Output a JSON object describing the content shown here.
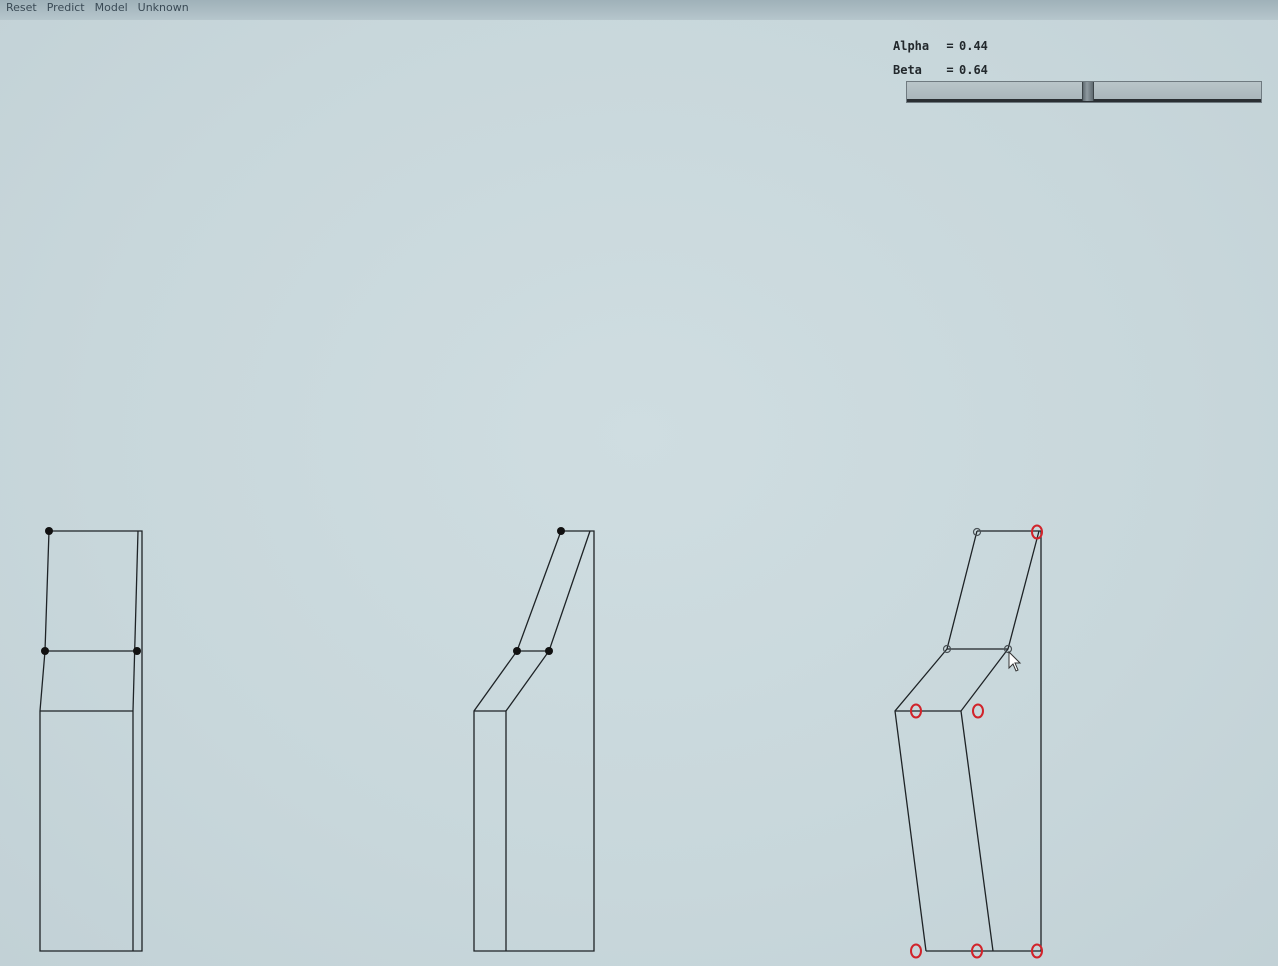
{
  "menu": {
    "items": [
      "Reset",
      "Predict",
      "Model",
      "Unknown"
    ]
  },
  "params": {
    "alpha": {
      "label": "Alpha",
      "eq": "=",
      "value": "0.44"
    },
    "beta": {
      "label": "Beta",
      "eq": "=",
      "value": "0.64"
    }
  },
  "slider": {
    "value": 0.51
  },
  "colors": {
    "background": "#c9d8dc",
    "line": "#1e2326",
    "handle": "#111111",
    "marker_red": "#d1232a"
  },
  "icons": {
    "pointer": "mouse-pointer-icon"
  }
}
